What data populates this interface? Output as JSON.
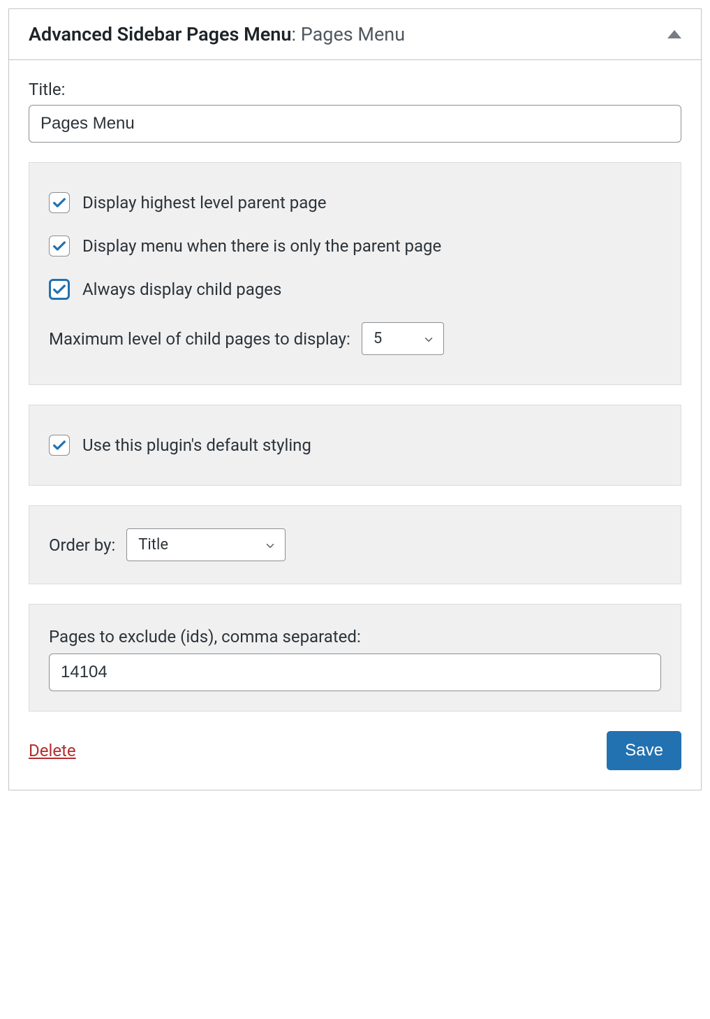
{
  "header": {
    "title": "Advanced Sidebar Pages Menu",
    "subtitle": "Pages Menu"
  },
  "title_field": {
    "label": "Title:",
    "value": "Pages Menu"
  },
  "display_panel": {
    "check_highest": {
      "label": "Display highest level parent page",
      "checked": true
    },
    "check_menu_only_parent": {
      "label": "Display menu when there is only the parent page",
      "checked": true
    },
    "check_always_child": {
      "label": "Always display child pages",
      "checked": true
    },
    "max_level": {
      "label": "Maximum level of child pages to display:",
      "value": "5"
    }
  },
  "styling_panel": {
    "check_default_styling": {
      "label": "Use this plugin's default styling",
      "checked": true
    }
  },
  "order_panel": {
    "label": "Order by:",
    "value": "Title"
  },
  "exclude_panel": {
    "label": "Pages to exclude (ids), comma separated:",
    "value": "14104"
  },
  "footer": {
    "delete": "Delete",
    "save": "Save"
  }
}
